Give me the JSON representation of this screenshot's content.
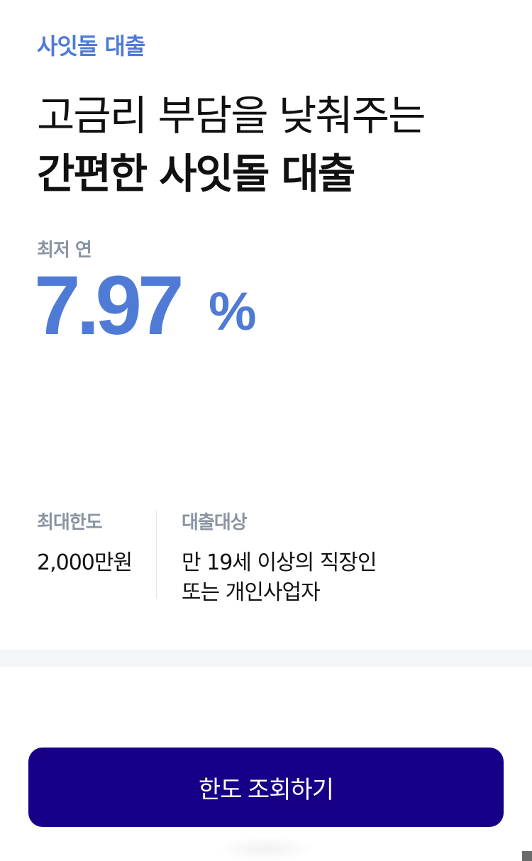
{
  "product": {
    "eyebrow": "사잇돌 대출"
  },
  "headline": {
    "line1": "고금리 부담을 낮춰주는",
    "line2": "간편한 사잇돌 대출"
  },
  "rate": {
    "label": "최저 연",
    "value": "7.97",
    "unit": "%"
  },
  "info": {
    "limit": {
      "label": "최대한도",
      "value": "2,000만원"
    },
    "target": {
      "label": "대출대상",
      "line1": "만 19세 이상의 직장인",
      "line2": "또는 개인사업자"
    }
  },
  "cta": {
    "label": "한도 조회하기"
  },
  "colors": {
    "accent": "#4f7bd6",
    "button": "#170087",
    "muted": "#8a94a3",
    "section_gap": "#f4f5f6"
  }
}
